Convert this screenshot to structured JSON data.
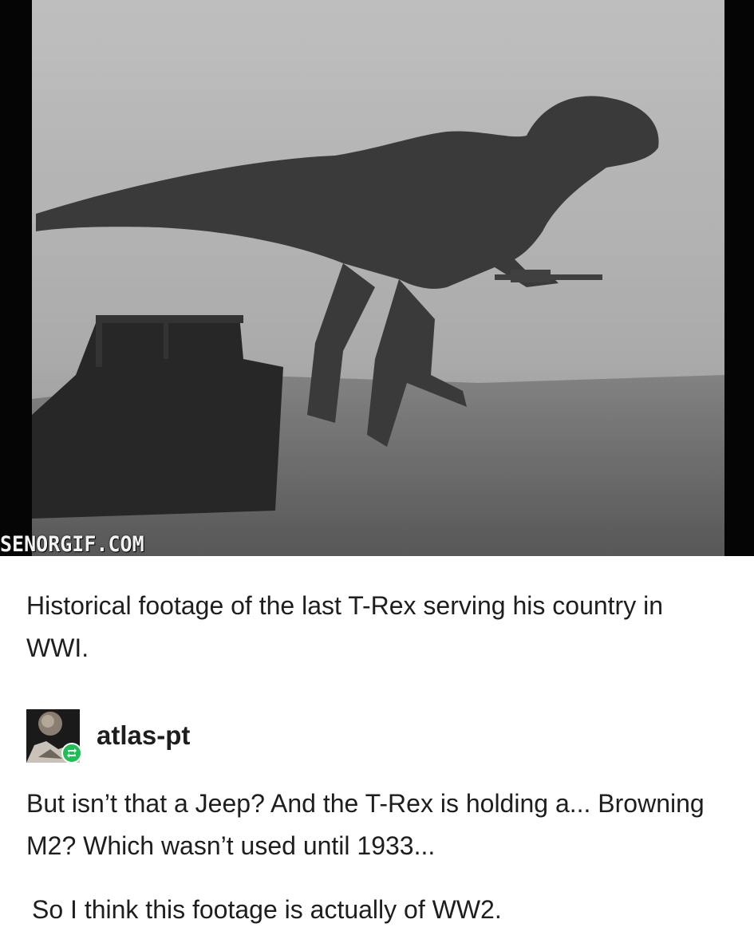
{
  "gif": {
    "watermark": "SENORGIF.COM",
    "subject": "trex-with-machine-gun-and-jeep"
  },
  "post": {
    "caption": "Historical footage of the last T-Rex serving his country in WWI."
  },
  "reblog": {
    "username": "atlas-pt",
    "avatar_icon": "avatar-image",
    "badge_icon": "reblog-icon",
    "badge_color": "#1fbf57",
    "paragraphs": [
      "But isn’t that a Jeep? And the T-Rex is holding a... Browning M2? Which wasn’t used until 1933...",
      "So I think this footage is actually of WW2."
    ]
  }
}
